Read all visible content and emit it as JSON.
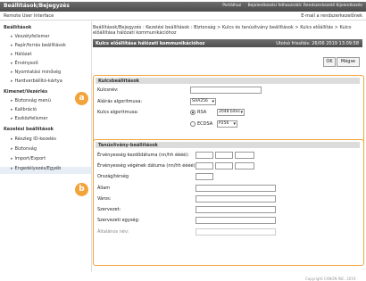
{
  "header": {
    "title": "Beállítások/Bejegyzés",
    "links": [
      "Portálhoz",
      "Bejelentkezési felhasználó: Rendszerkezelő Kijelentkezés"
    ],
    "user": "Remote User Interface",
    "email": "E-mail a rendszerkezelőnek"
  },
  "sidebar": {
    "groups": [
      {
        "title": "Beállítások",
        "items": [
          "Veszélyfelismer",
          "Papír/forrás beállítások",
          "Hálózat",
          "Érvényező",
          "Nyomtatási minőség",
          "Hardverbállító-kártya"
        ]
      },
      {
        "title": "Kimenet/Vezérlés",
        "items": [
          "Biztonság menü",
          "Kalibráció",
          "Eszközfelismer"
        ]
      },
      {
        "title": "Kezelési beállítások",
        "items": [
          "Részleg ID-kezelés",
          "Biztonság",
          "Import/Export",
          "Engedélyezés/Egyéb"
        ]
      }
    ]
  },
  "main": {
    "breadcrumb": "Beállítások/Bejegyzés : Kezelési beállítások : Biztonság > Kulcs és tanúsítvány beállítások > Kulcs előállítás > Kulcs előállítása hálózati kommunikációhoz",
    "page_title": "Kulcs előállítása hálózati kommunikációhoz",
    "last_updated": "Utolsó frissítés: 26/06 2019 13:09:58",
    "ok_label": "OK",
    "cancel_label": "Mégse",
    "key_section": {
      "title": "Kulcsbeállítások",
      "key_name_label": "Kulcsnév:",
      "key_name_value": "",
      "signature_label": "Aláírás algoritmusa:",
      "signature_value": "SHA256",
      "key_algo_label": "Kulcs algoritmusa:",
      "rsa_label": "RSA",
      "rsa_bits": "2048 bites",
      "ecdsa_label": "ECDSA",
      "ecdsa_curve": "P256"
    },
    "cert_section": {
      "title": "Tanúsítvány-beállítások",
      "start_label": "Érvényesség kezdődátuma (nn/hh éééé):",
      "end_label": "Érvényesség végének dátuma (nn/hh éééé):",
      "country_label": "Ország/térség",
      "state_label": "Állam",
      "city_label": "Város:",
      "org_label": "Szervezet:",
      "unit_label": "Szervezeti egység:",
      "common_label": "Általános név:"
    },
    "badges": [
      "a",
      "b"
    ],
    "copyright": "Copyright CANON INC. 2019"
  }
}
